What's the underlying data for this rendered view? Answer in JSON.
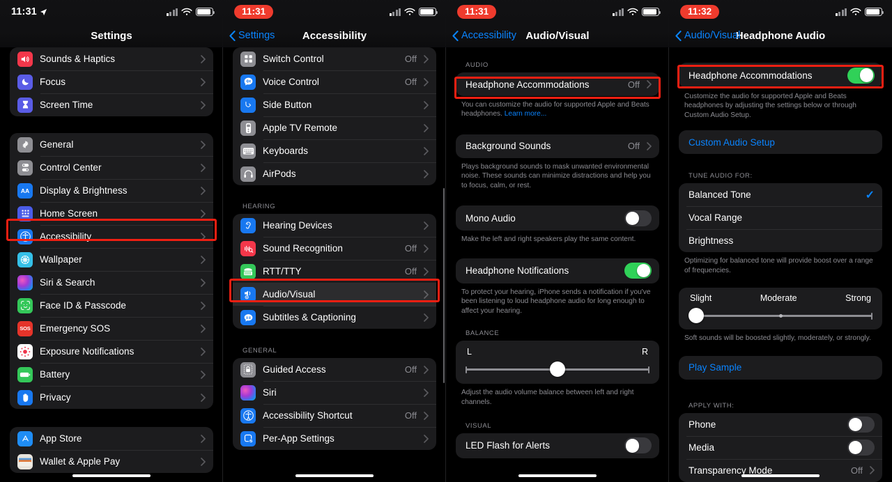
{
  "statusbar": {
    "panel1_time": "11:31",
    "panel2_time": "11:31",
    "panel3_time": "11:31",
    "panel4_time": "11:32",
    "recording_pill_color": "#ef3b2d"
  },
  "panel1": {
    "nav": {
      "title": "Settings"
    },
    "groups": [
      {
        "rows": [
          {
            "label": "Sounds & Haptics",
            "value": "",
            "icon": "speaker-icon",
            "tile_color": "#f4374a",
            "chevron": true
          },
          {
            "label": "Focus",
            "value": "",
            "icon": "moon-icon",
            "tile_color": "#5a5ce6",
            "chevron": true
          },
          {
            "label": "Screen Time",
            "value": "",
            "icon": "hourglass-icon",
            "tile_color": "#5a5ce6",
            "chevron": true
          }
        ]
      },
      {
        "rows": [
          {
            "label": "General",
            "value": "",
            "icon": "gear-icon",
            "tile_color": "#8e8e93",
            "chevron": true
          },
          {
            "label": "Control Center",
            "value": "",
            "icon": "control-center-icon",
            "tile_color": "#8e8e93",
            "chevron": true
          },
          {
            "label": "Display & Brightness",
            "value": "",
            "icon": "display-brightness-icon",
            "tile_color": "#1878f0",
            "chevron": true
          },
          {
            "label": "Home Screen",
            "value": "",
            "icon": "home-screen-icon",
            "tile_color": "#4a5ce8",
            "chevron": true
          },
          {
            "label": "Accessibility",
            "value": "",
            "icon": "accessibility-icon",
            "tile_color": "#1878f0",
            "chevron": true,
            "highlighted": true
          },
          {
            "label": "Wallpaper",
            "value": "",
            "icon": "wallpaper-icon",
            "tile_color": "#35c0e8",
            "chevron": true
          },
          {
            "label": "Siri & Search",
            "value": "",
            "icon": "siri-icon",
            "tile_color": "#9c3ad0",
            "chevron": true
          },
          {
            "label": "Face ID & Passcode",
            "value": "",
            "icon": "face-id-icon",
            "tile_color": "#34c759",
            "chevron": true
          },
          {
            "label": "Emergency SOS",
            "value": "",
            "icon": "sos-icon",
            "tile_color": "#e5342a",
            "chevron": true
          },
          {
            "label": "Exposure Notifications",
            "value": "",
            "icon": "exposure-notifications-icon",
            "tile_color": "#ffffff",
            "chevron": true
          },
          {
            "label": "Battery",
            "value": "",
            "icon": "battery-icon",
            "tile_color": "#34c759",
            "chevron": true
          },
          {
            "label": "Privacy",
            "value": "",
            "icon": "privacy-hand-icon",
            "tile_color": "#1878f0",
            "chevron": true
          }
        ]
      },
      {
        "rows": [
          {
            "label": "App Store",
            "value": "",
            "icon": "app-store-icon",
            "tile_color": "#1f8df5",
            "chevron": true
          },
          {
            "label": "Wallet & Apple Pay",
            "value": "",
            "icon": "wallet-icon",
            "tile_color": "#2c2c2e",
            "chevron": true
          }
        ]
      }
    ]
  },
  "panel2": {
    "nav": {
      "back": "Settings",
      "title": "Accessibility"
    },
    "groups": [
      {
        "header": "",
        "rows": [
          {
            "label": "Switch Control",
            "value": "Off",
            "icon": "switch-control-icon",
            "tile_color": "#8e8e93",
            "chevron": true
          },
          {
            "label": "Voice Control",
            "value": "Off",
            "icon": "voice-control-icon",
            "tile_color": "#1878f0",
            "chevron": true
          },
          {
            "label": "Side Button",
            "value": "",
            "icon": "side-button-icon",
            "tile_color": "#1878f0",
            "chevron": true
          },
          {
            "label": "Apple TV Remote",
            "value": "",
            "icon": "apple-tv-remote-icon",
            "tile_color": "#8e8e93",
            "chevron": true
          },
          {
            "label": "Keyboards",
            "value": "",
            "icon": "keyboard-icon",
            "tile_color": "#8e8e93",
            "chevron": true
          },
          {
            "label": "AirPods",
            "value": "",
            "icon": "airpods-icon",
            "tile_color": "#8e8e93",
            "chevron": true
          }
        ]
      },
      {
        "header": "HEARING",
        "rows": [
          {
            "label": "Hearing Devices",
            "value": "",
            "icon": "hearing-devices-icon",
            "tile_color": "#1878f0",
            "chevron": true
          },
          {
            "label": "Sound Recognition",
            "value": "Off",
            "icon": "sound-recognition-icon",
            "tile_color": "#f4374a",
            "chevron": true
          },
          {
            "label": "RTT/TTY",
            "value": "Off",
            "icon": "rtt-tty-icon",
            "tile_color": "#34c759",
            "chevron": true
          },
          {
            "label": "Audio/Visual",
            "value": "",
            "icon": "audio-visual-icon",
            "tile_color": "#1878f0",
            "chevron": true,
            "highlighted": true,
            "selected": true
          },
          {
            "label": "Subtitles & Captioning",
            "value": "",
            "icon": "subtitles-icon",
            "tile_color": "#1878f0",
            "chevron": true
          }
        ]
      },
      {
        "header": "GENERAL",
        "rows": [
          {
            "label": "Guided Access",
            "value": "Off",
            "icon": "guided-access-icon",
            "tile_color": "#8e8e93",
            "chevron": true
          },
          {
            "label": "Siri",
            "value": "",
            "icon": "siri-icon",
            "tile_color": "#9c3ad0",
            "chevron": true
          },
          {
            "label": "Accessibility Shortcut",
            "value": "Off",
            "icon": "accessibility-icon",
            "tile_color": "#1878f0",
            "chevron": true
          },
          {
            "label": "Per-App Settings",
            "value": "",
            "icon": "per-app-settings-icon",
            "tile_color": "#1878f0",
            "chevron": true
          }
        ]
      }
    ]
  },
  "panel3": {
    "nav": {
      "back": "Accessibility",
      "title": "Audio/Visual"
    },
    "audio_header": "AUDIO",
    "headphone_accommodations": {
      "label": "Headphone Accommodations",
      "value": "Off"
    },
    "headphone_accommodations_note": "You can customize the audio for supported Apple and Beats headphones. ",
    "headphone_accommodations_link": "Learn more...",
    "background_sounds": {
      "label": "Background Sounds",
      "value": "Off"
    },
    "background_sounds_note": "Plays background sounds to mask unwanted environmental noise. These sounds can minimize distractions and help you to focus, calm, or rest.",
    "mono_audio": {
      "label": "Mono Audio",
      "on": false
    },
    "mono_audio_note": "Make the left and right speakers play the same content.",
    "headphone_notifications": {
      "label": "Headphone Notifications",
      "on": true
    },
    "headphone_notifications_note": "To protect your hearing, iPhone sends a notification if you've been listening to loud headphone audio for long enough to affect your hearing.",
    "balance_header": "BALANCE",
    "balance_left": "L",
    "balance_right": "R",
    "balance_note": "Adjust the audio volume balance between left and right channels.",
    "visual_header": "VISUAL",
    "led_flash": {
      "label": "LED Flash for Alerts",
      "on": false
    }
  },
  "panel4": {
    "nav": {
      "back": "Audio/Visual",
      "title": "Headphone Audio"
    },
    "headphone_accommodations": {
      "label": "Headphone Accommodations",
      "on": true
    },
    "headphone_accommodations_note": "Customize the audio for supported Apple and Beats headphones by adjusting the settings below or through Custom Audio Setup.",
    "custom_audio_setup": "Custom Audio Setup",
    "tune_header": "TUNE AUDIO FOR:",
    "tune_options": [
      {
        "label": "Balanced Tone",
        "checked": true
      },
      {
        "label": "Vocal Range",
        "checked": false
      },
      {
        "label": "Brightness",
        "checked": false
      }
    ],
    "tune_note": "Optimizing for balanced tone will provide boost over a range of frequencies.",
    "strength_labels": {
      "slight": "Slight",
      "moderate": "Moderate",
      "strong": "Strong"
    },
    "strength_note": "Soft sounds will be boosted slightly, moderately, or strongly.",
    "play_sample": "Play Sample",
    "apply_header": "APPLY WITH:",
    "apply_rows": [
      {
        "label": "Phone",
        "type": "toggle",
        "on": false
      },
      {
        "label": "Media",
        "type": "toggle",
        "on": false
      },
      {
        "label": "Transparency Mode",
        "type": "value",
        "value": "Off"
      }
    ]
  }
}
